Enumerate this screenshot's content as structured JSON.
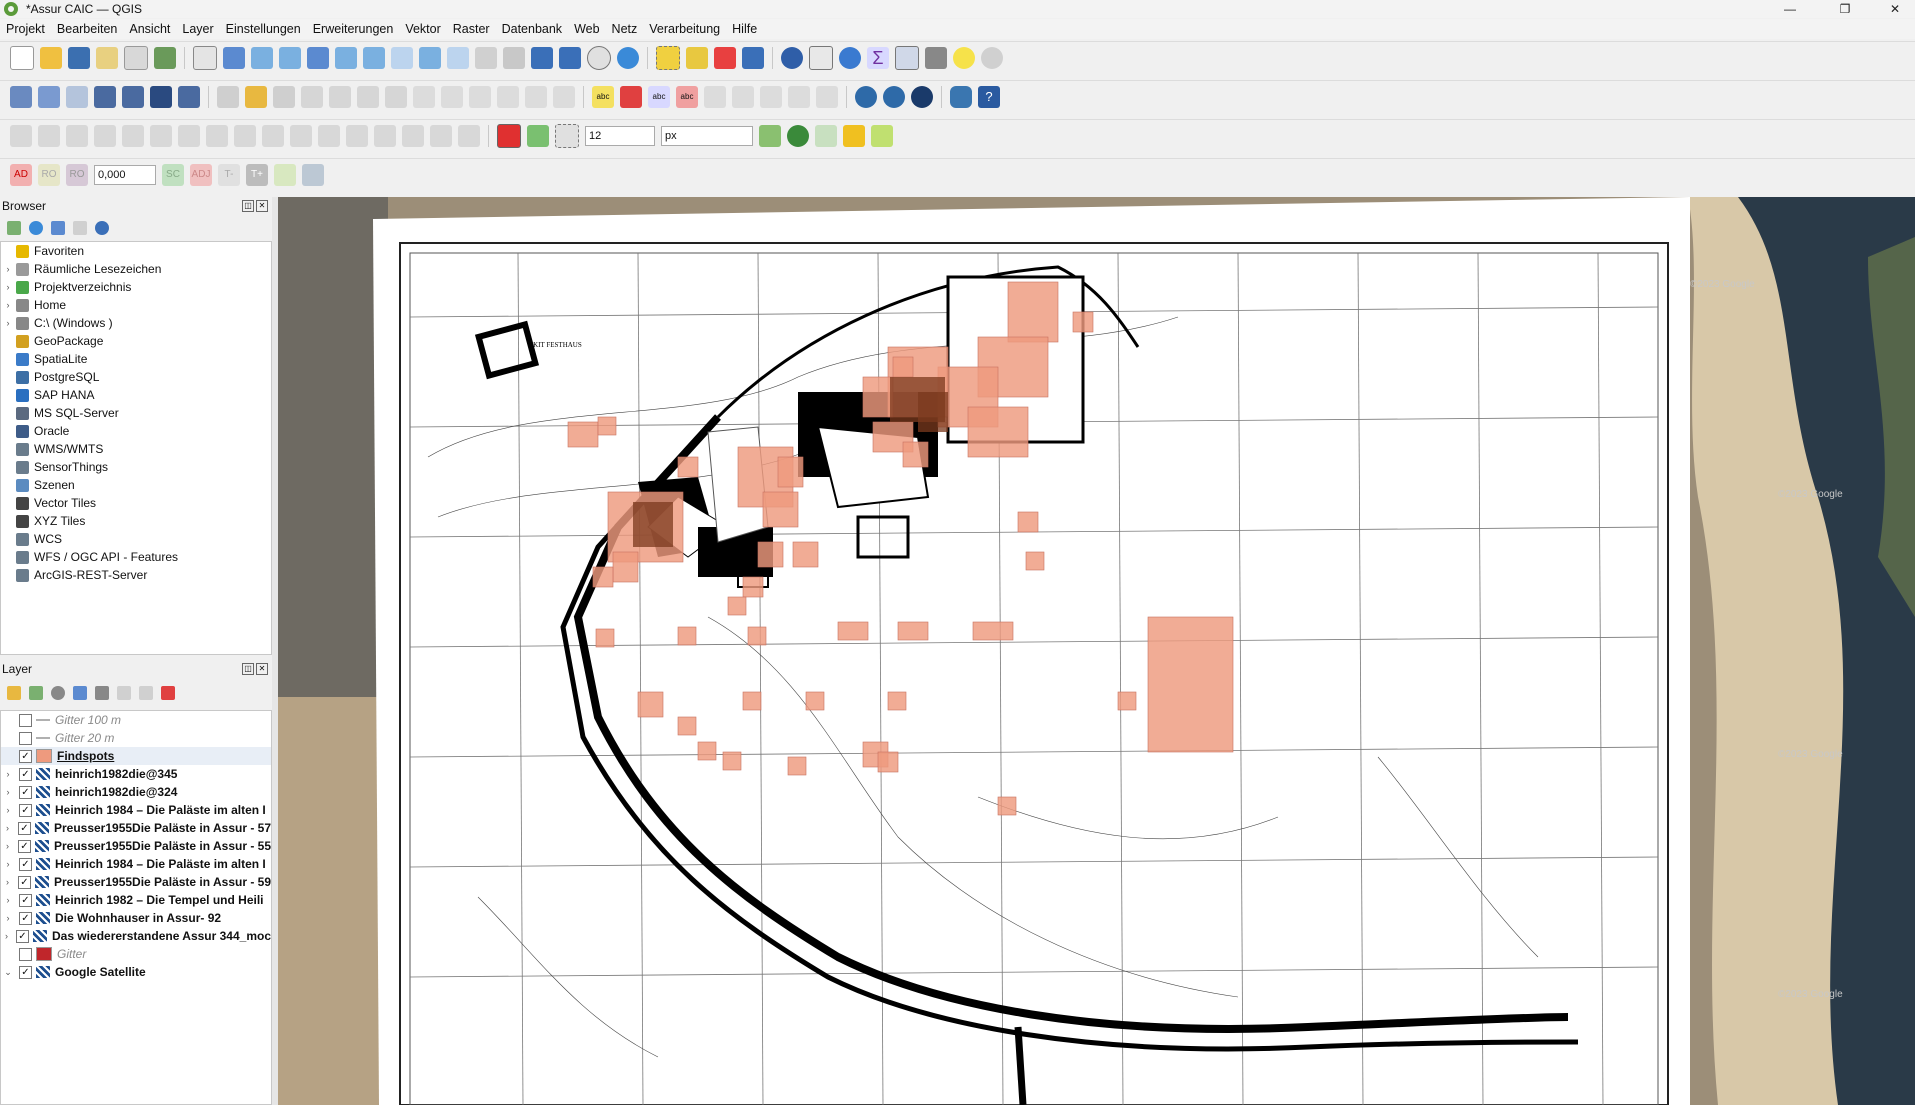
{
  "window": {
    "title": "*Assur CAIC — QGIS",
    "min": "—",
    "max": "❐",
    "close": "✕"
  },
  "menu": [
    "Projekt",
    "Bearbeiten",
    "Ansicht",
    "Layer",
    "Einstellungen",
    "Erweiterungen",
    "Vektor",
    "Raster",
    "Datenbank",
    "Web",
    "Netz",
    "Verarbeitung",
    "Hilfe"
  ],
  "toolbar": {
    "snap_tolerance": "12",
    "snap_unit": "px",
    "angle_value": "0,000",
    "advanced_digitize": {
      "ad": "AD",
      "ro": "RO",
      "ro2": "RO",
      "sc": "SC",
      "adj": "ADJ",
      "tm": "T-",
      "tp": "T+"
    }
  },
  "browser": {
    "title": "Browser",
    "items": [
      {
        "label": "Favoriten",
        "icon": "star-icon",
        "color": "#e6b800",
        "expand": false
      },
      {
        "label": "Räumliche Lesezeichen",
        "icon": "bookmark-icon",
        "color": "#9a9a9a",
        "expand": true
      },
      {
        "label": "Projektverzeichnis",
        "icon": "project-folder-icon",
        "color": "#4aa84a",
        "expand": true
      },
      {
        "label": "Home",
        "icon": "home-folder-icon",
        "color": "#888",
        "expand": true
      },
      {
        "label": "C:\\ (Windows )",
        "icon": "drive-icon",
        "color": "#888",
        "expand": true
      },
      {
        "label": "GeoPackage",
        "icon": "geopackage-icon",
        "color": "#d2a020",
        "expand": false
      },
      {
        "label": "SpatiaLite",
        "icon": "spatialite-icon",
        "color": "#3b7bc8",
        "expand": false
      },
      {
        "label": "PostgreSQL",
        "icon": "postgresql-icon",
        "color": "#3d6fa5",
        "expand": false
      },
      {
        "label": "SAP HANA",
        "icon": "saphana-icon",
        "color": "#2a6fc0",
        "expand": false
      },
      {
        "label": "MS SQL-Server",
        "icon": "mssql-icon",
        "color": "#5b6a80",
        "expand": false
      },
      {
        "label": "Oracle",
        "icon": "oracle-icon",
        "color": "#3e5c88",
        "expand": false
      },
      {
        "label": "WMS/WMTS",
        "icon": "wms-icon",
        "color": "#6a7c8c",
        "expand": false
      },
      {
        "label": "SensorThings",
        "icon": "sensorthings-icon",
        "color": "#6a7c8c",
        "expand": false
      },
      {
        "label": "Szenen",
        "icon": "scenes-icon",
        "color": "#5b8bc0",
        "expand": false
      },
      {
        "label": "Vector Tiles",
        "icon": "vector-tiles-icon",
        "color": "#444",
        "expand": false
      },
      {
        "label": "XYZ Tiles",
        "icon": "xyz-tiles-icon",
        "color": "#444",
        "expand": false
      },
      {
        "label": "WCS",
        "icon": "wcs-icon",
        "color": "#6a7c8c",
        "expand": false
      },
      {
        "label": "WFS / OGC API - Features",
        "icon": "wfs-icon",
        "color": "#6a7c8c",
        "expand": false
      },
      {
        "label": "ArcGIS-REST-Server",
        "icon": "arcgis-icon",
        "color": "#6a7c8c",
        "expand": false
      }
    ]
  },
  "layers": {
    "title": "Layer",
    "items": [
      {
        "label": "Gitter 100 m",
        "checked": false,
        "style": "ital",
        "sym": "line",
        "color": "#b0b0b0",
        "expand": false
      },
      {
        "label": "Gitter 20 m",
        "checked": false,
        "style": "ital",
        "sym": "line",
        "color": "#b0b0b0",
        "expand": false
      },
      {
        "label": "Findspots",
        "checked": true,
        "style": "bold-u",
        "sym": "fill",
        "color": "#ee9a7e",
        "expand": false,
        "selected": true
      },
      {
        "label": "heinrich1982die@345",
        "checked": true,
        "style": "bold",
        "sym": "raster",
        "color": "#1e4f8f",
        "expand": true
      },
      {
        "label": "heinrich1982die@324",
        "checked": true,
        "style": "bold",
        "sym": "raster",
        "color": "#1e4f8f",
        "expand": true
      },
      {
        "label": "Heinrich 1984 – Die Paläste im alten I",
        "checked": true,
        "style": "bold",
        "sym": "raster",
        "color": "#1e4f8f",
        "expand": true
      },
      {
        "label": "Preusser1955Die Paläste in Assur - 57",
        "checked": true,
        "style": "bold",
        "sym": "raster",
        "color": "#1e4f8f",
        "expand": true
      },
      {
        "label": "Preusser1955Die Paläste in Assur - 55",
        "checked": true,
        "style": "bold",
        "sym": "raster",
        "color": "#1e4f8f",
        "expand": true
      },
      {
        "label": "Heinrich 1984 – Die Paläste im alten I",
        "checked": true,
        "style": "bold",
        "sym": "raster",
        "color": "#1e4f8f",
        "expand": true
      },
      {
        "label": "Preusser1955Die Paläste in Assur - 59",
        "checked": true,
        "style": "bold",
        "sym": "raster",
        "color": "#1e4f8f",
        "expand": true
      },
      {
        "label": "Heinrich 1982 – Die Tempel und Heili",
        "checked": true,
        "style": "bold",
        "sym": "raster",
        "color": "#1e4f8f",
        "expand": true
      },
      {
        "label": "Die Wohnhauser in Assur- 92",
        "checked": true,
        "style": "bold",
        "sym": "raster",
        "color": "#1e4f8f",
        "expand": true
      },
      {
        "label": "Das wiedererstandene Assur 344_moc",
        "checked": true,
        "style": "bold",
        "sym": "raster",
        "color": "#1e4f8f",
        "expand": true
      },
      {
        "label": "Gitter",
        "checked": false,
        "style": "ital",
        "sym": "fill",
        "color": "#c0262b",
        "expand": false
      },
      {
        "label": "Google Satellite",
        "checked": true,
        "style": "bold",
        "sym": "raster",
        "color": "#1e4f8f",
        "expand": true,
        "open": true
      }
    ]
  },
  "map": {
    "watermarks": [
      "©2023 Google",
      "©2023 Google",
      "©2023 Google",
      "©2023 Google"
    ]
  }
}
